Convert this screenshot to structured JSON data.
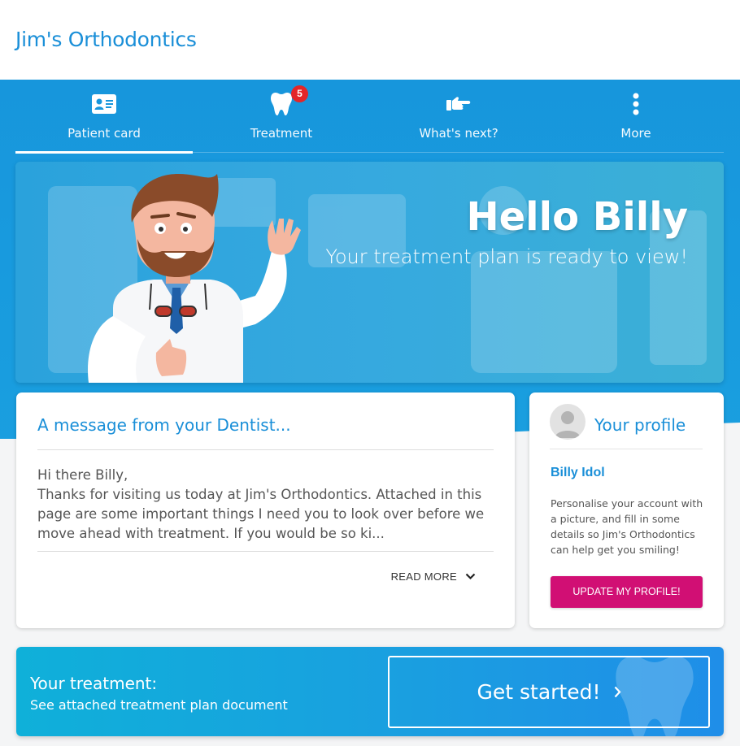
{
  "header": {
    "brand": "Jim's Orthodontics"
  },
  "tabs": [
    {
      "label": "Patient card",
      "icon": "id-card-icon",
      "active": true
    },
    {
      "label": "Treatment",
      "icon": "tooth-icon",
      "badge": "5"
    },
    {
      "label": "What's next?",
      "icon": "pointing-hand-icon"
    },
    {
      "label": "More",
      "icon": "more-vertical-icon"
    }
  ],
  "hero": {
    "greeting": "Hello Billy",
    "subtitle": "Your treatment plan is ready to view!"
  },
  "message": {
    "title": "A message from your Dentist...",
    "greeting": "Hi there Billy,",
    "body": "Thanks for visiting us today at Jim's Orthodontics. Attached in this page are some important things I need you to look over before we move ahead with treatment. If you would be so ki...",
    "read_more": "READ MORE"
  },
  "profile": {
    "title": "Your profile",
    "name": "Billy Idol",
    "description": "Personalise your account with a picture, and fill in some details so Jim's Orthodontics can help get you smiling!",
    "button": "UPDATE MY PROFILE!"
  },
  "treatment": {
    "title": "Your treatment:",
    "subtitle": "See attached treatment plan document",
    "button": "Get started!"
  },
  "colors": {
    "brand_blue": "#1a8fd8",
    "band_blue": "#1796dc",
    "accent_pink": "#d10f74",
    "badge_red": "#e32629"
  }
}
